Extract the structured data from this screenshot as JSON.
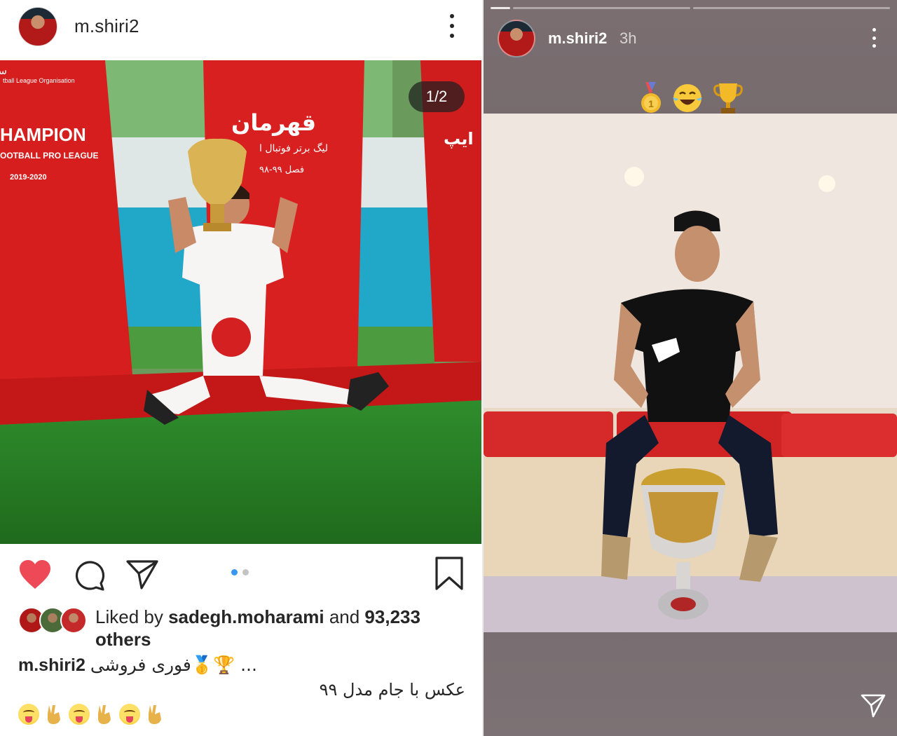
{
  "post": {
    "username": "m.shiri2",
    "counter": "1/2",
    "liked_by_prefix": "Liked by ",
    "liked_by_user": "sadegh.moharami",
    "liked_by_and": " and ",
    "liked_by_count": "93,233",
    "liked_by_suffix": "others",
    "caption_user": "m.shiri2",
    "caption_text": "فوری فروشی🥇🏆 ...",
    "caption_second_line": "عکس با جام مدل ۹۹",
    "carousel": {
      "total": 2,
      "current": 1
    },
    "photo_text": {
      "league_org_fa": "سازمان لیگ فوتبال",
      "league_org_en": "tball League Organisation",
      "champion": "HAMPION",
      "pro_league": "OOTBALL PRO LEAGUE",
      "season": "2019-2020",
      "champion_fa": "قهرمان",
      "league_fa": "لیگ برتر فوتبال ا",
      "season_fa": "فصل ۹۹-۹۸",
      "side_fa": "ایپ"
    }
  },
  "story": {
    "username": "m.shiri2",
    "time": "3h",
    "segments": 2,
    "active_segment": 1
  },
  "colors": {
    "heart": "#ed4956",
    "dot_active": "#3897f0",
    "text": "#262626"
  },
  "icons": {
    "like": "heart-icon",
    "comment": "comment-icon",
    "share": "send-icon",
    "save": "bookmark-icon",
    "more": "more-vertical-icon"
  }
}
